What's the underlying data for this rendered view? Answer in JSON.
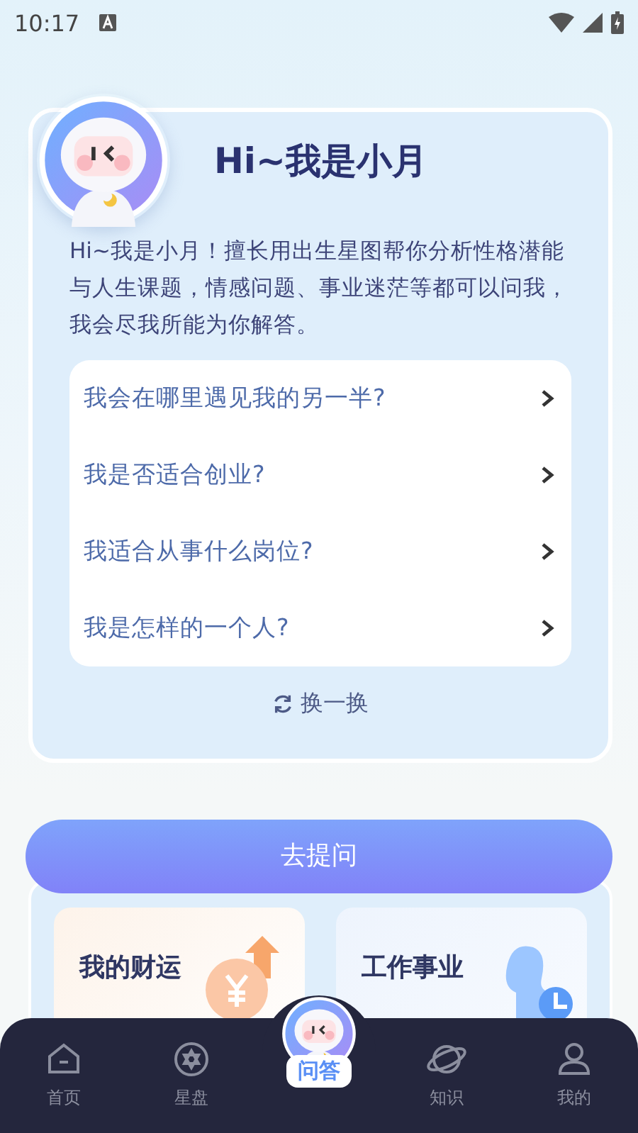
{
  "status_bar": {
    "time": "10:17"
  },
  "assistant": {
    "title": "Hi~我是小月",
    "intro": "Hi~我是小月！擅长用出生星图帮你分析性格潜能与人生课题，情感问题、事业迷茫等都可以问我，我会尽我所能为你解答。",
    "questions": [
      "我会在哪里遇见我的另一半?",
      "我是否适合创业?",
      "我适合从事什么岗位?",
      "我是怎样的一个人?"
    ],
    "refresh": "换一换"
  },
  "ask_button": "去提问",
  "topics": [
    {
      "kind": "wealth",
      "label": "我的财运"
    },
    {
      "kind": "career",
      "label": "工作事业"
    }
  ],
  "tabs": [
    {
      "kind": "home",
      "label": "首页",
      "selected": false
    },
    {
      "kind": "chart",
      "label": "星盘",
      "selected": false
    },
    {
      "kind": "qa",
      "label": "问答",
      "selected": true
    },
    {
      "kind": "knowledge",
      "label": "知识",
      "selected": false
    },
    {
      "kind": "me",
      "label": "我的",
      "selected": false
    }
  ]
}
